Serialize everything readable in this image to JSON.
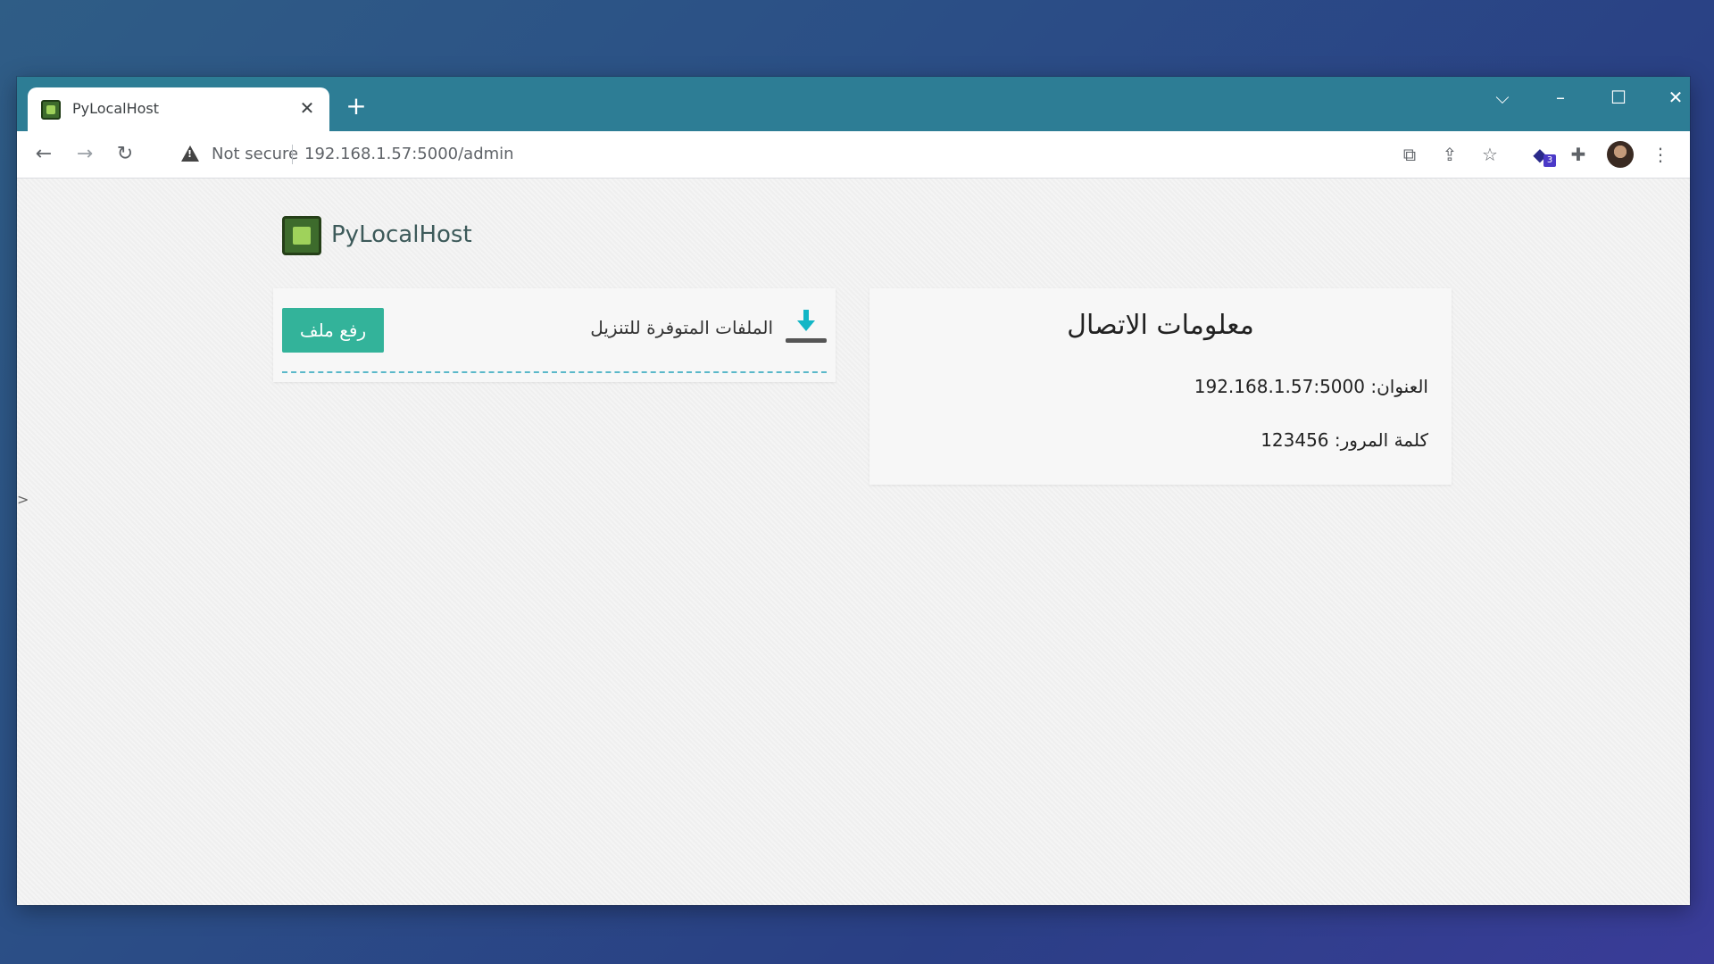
{
  "browser": {
    "tab_title": "PyLocalHost",
    "tab_close_icon": "close-icon",
    "new_tab_icon": "plus-icon",
    "security_label": "Not secure",
    "url": "192.168.1.57:5000/admin",
    "extension_badge_count": "3"
  },
  "app": {
    "logo_text": "PyLocalHost",
    "files_panel": {
      "upload_button": "رفع ملف",
      "title": "الملفات المتوفرة للتنزيل"
    },
    "connection_panel": {
      "title": "معلومات الاتصال",
      "address_line": "العنوان: 192.168.1.57:5000",
      "password_line": "كلمة المرور: 123456"
    }
  },
  "colors": {
    "titlebar": "#2d7d95",
    "upload_button": "#33b39a",
    "download_icon": "#12b6c6"
  }
}
